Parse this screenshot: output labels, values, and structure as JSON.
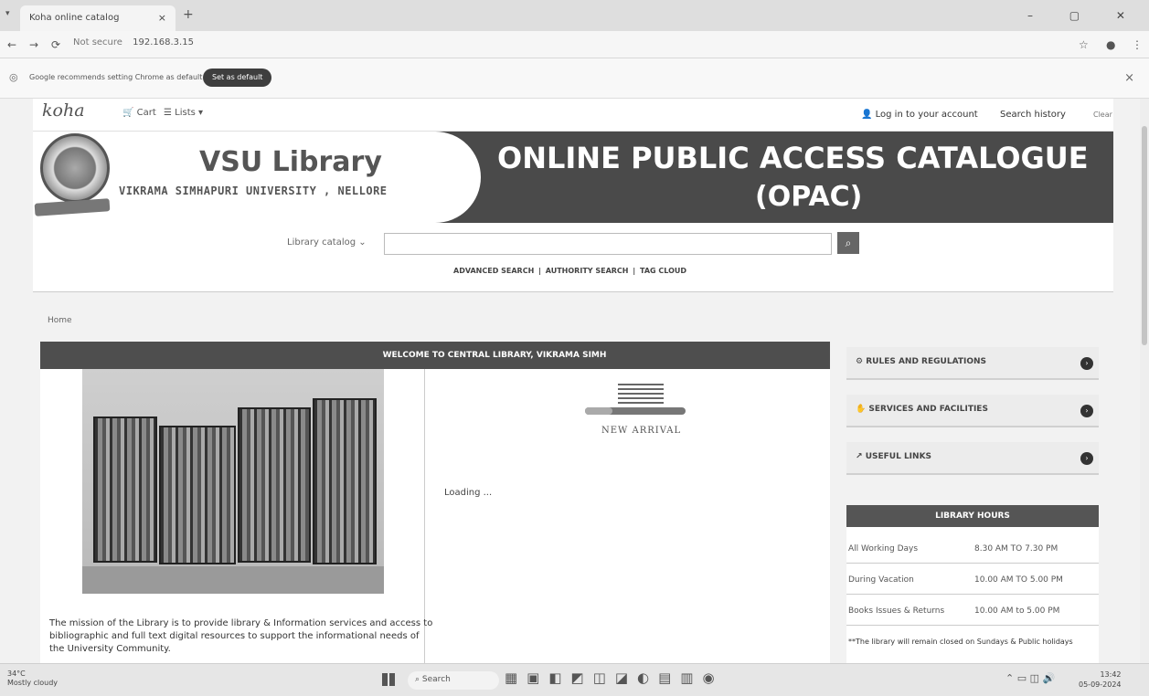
{
  "browser": {
    "tab_title": "Koha online catalog",
    "tab_close": "×",
    "new_tab": "+",
    "url_warning": "Not secure",
    "url": "192.168.3.15",
    "window_controls": "– ▢ ✕",
    "infobar_message": "Google recommends setting Chrome as default",
    "infobar_button": "Set as default",
    "infobar_close": "×"
  },
  "koha_bar": {
    "logo": "koha",
    "cart": "Cart",
    "lists": "Lists ▾",
    "login": "Log in to your account",
    "search_history": "Search history",
    "clear": "Clear"
  },
  "banner": {
    "library_name": "VSU Library",
    "university": "VIKRAMA SIMHAPURI UNIVERSITY , NELLORE",
    "opac_line1": "ONLINE PUBLIC ACCESS CATALOGUE",
    "opac_line2": "(OPAC)"
  },
  "search": {
    "scope": "Library catalog",
    "placeholder": "",
    "links": [
      "ADVANCED SEARCH",
      "AUTHORITY SEARCH",
      "TAG CLOUD"
    ]
  },
  "breadcrumb": "Home",
  "main": {
    "welcome": "WELCOME TO CENTRAL LIBRARY, VIKRAMA SIMH",
    "new_arrival": "NEW ARRIVAL",
    "loading": "Loading ...",
    "mission": "The mission of the Library is to provide library & Information services and access to bibliographic and full text digital resources to support the informational needs of the University Community."
  },
  "sidebar": {
    "items": [
      {
        "label": "RULES AND REGULATIONS"
      },
      {
        "label": "SERVICES AND FACILITIES"
      },
      {
        "label": "USEFUL LINKS"
      }
    ],
    "hours_title": "LIBRARY HOURS",
    "hours": [
      {
        "when": "All Working Days",
        "time": "8.30 AM TO 7.30 PM"
      },
      {
        "when": "During Vacation",
        "time": "10.00 AM TO 5.00 PM"
      },
      {
        "when": "Books Issues & Returns",
        "time": "10.00 AM to 5.00 PM"
      }
    ],
    "note": "**The library will remain closed on Sundays & Public holidays"
  },
  "taskbar": {
    "weather_temp": "34°C",
    "weather_desc": "Mostly cloudy",
    "search": "Search",
    "time": "13:42",
    "date": "05-09-2024"
  }
}
